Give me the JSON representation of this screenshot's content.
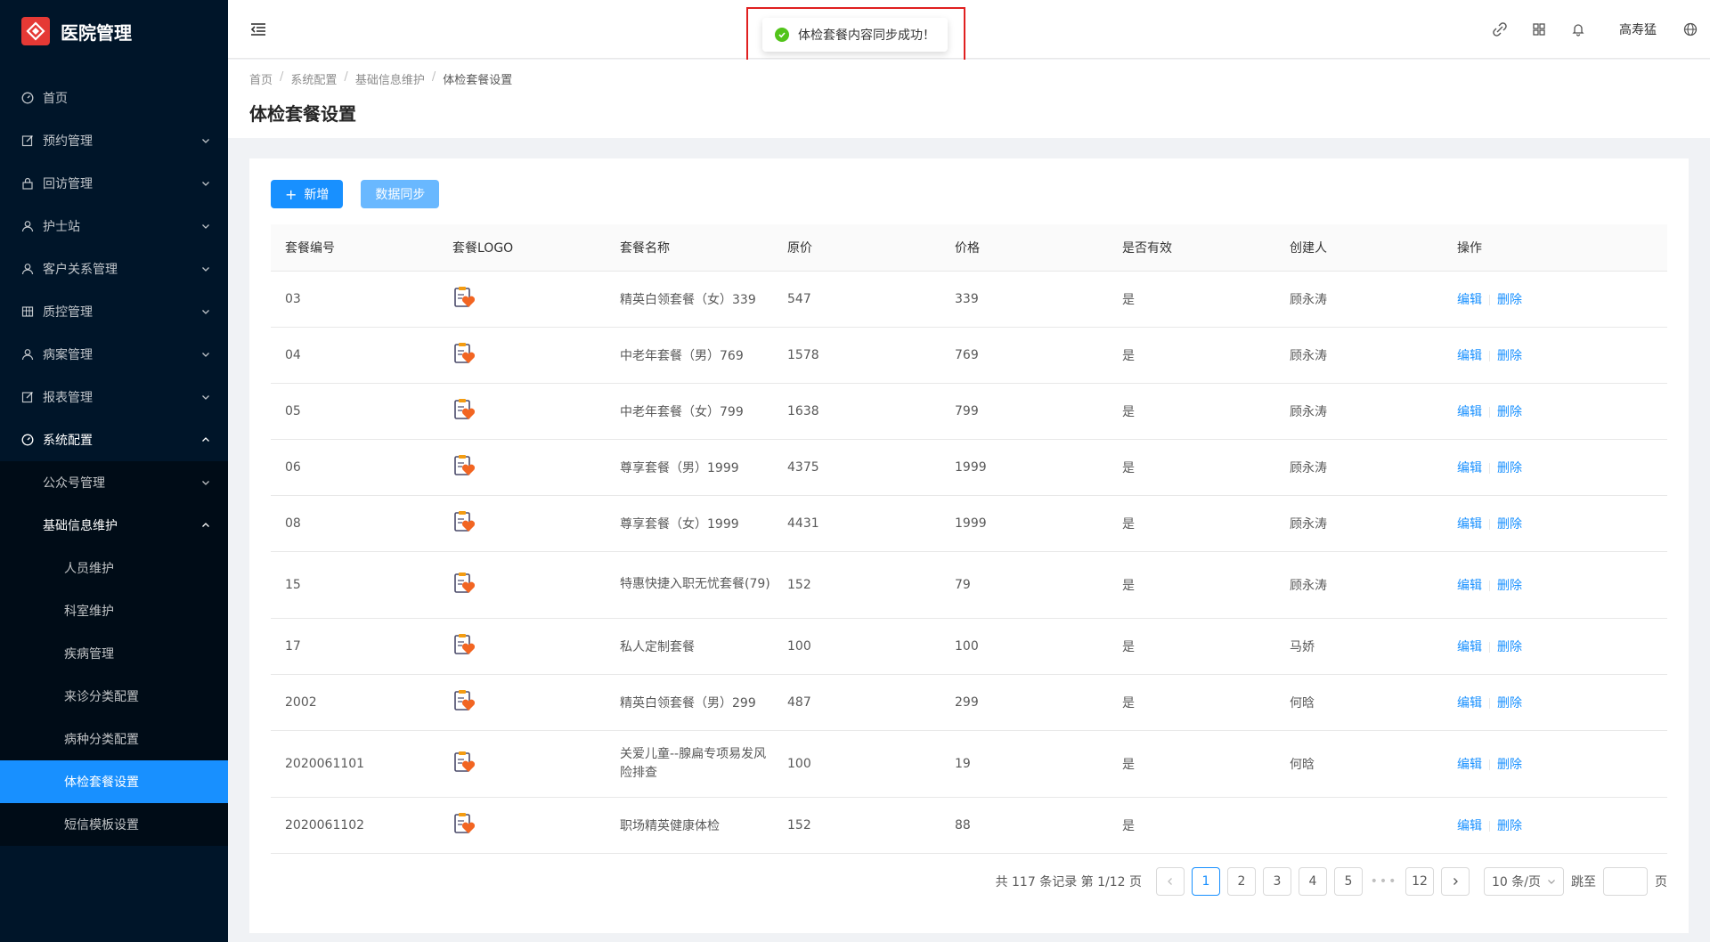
{
  "app": {
    "title": "医院管理"
  },
  "sidebar": {
    "items": [
      {
        "label": "首页",
        "icon": "dashboard-icon",
        "has_children": false
      },
      {
        "label": "预约管理",
        "icon": "edit-icon",
        "has_children": true
      },
      {
        "label": "回访管理",
        "icon": "lock-icon",
        "has_children": true
      },
      {
        "label": "护士站",
        "icon": "user-icon",
        "has_children": true
      },
      {
        "label": "客户关系管理",
        "icon": "user-icon",
        "has_children": true
      },
      {
        "label": "质控管理",
        "icon": "table-icon",
        "has_children": true
      },
      {
        "label": "病案管理",
        "icon": "user-icon",
        "has_children": true
      },
      {
        "label": "报表管理",
        "icon": "edit-icon",
        "has_children": true
      },
      {
        "label": "系统配置",
        "icon": "dashboard-icon",
        "has_children": true,
        "open": true
      }
    ],
    "system_sub": [
      {
        "label": "公众号管理",
        "open": false
      },
      {
        "label": "基础信息维护",
        "open": true
      }
    ],
    "basic_sub": [
      {
        "label": "人员维护"
      },
      {
        "label": "科室维护"
      },
      {
        "label": "疾病管理"
      },
      {
        "label": "来诊分类配置"
      },
      {
        "label": "病种分类配置"
      },
      {
        "label": "体检套餐设置",
        "selected": true
      },
      {
        "label": "短信模板设置"
      }
    ]
  },
  "header": {
    "user_name": "高寿猛"
  },
  "toast": {
    "message": "体检套餐内容同步成功！"
  },
  "breadcrumb": [
    "首页",
    "系统配置",
    "基础信息维护",
    "体检套餐设置"
  ],
  "page": {
    "title": "体检套餐设置"
  },
  "toolbar": {
    "add_label": "新增",
    "sync_label": "数据同步"
  },
  "table": {
    "columns": [
      "套餐编号",
      "套餐LOGO",
      "套餐名称",
      "原价",
      "价格",
      "是否有效",
      "创建人",
      "操作"
    ],
    "actions": {
      "edit": "编辑",
      "delete": "删除"
    },
    "rows": [
      {
        "id": "03",
        "name": "精英白领套餐（女）339",
        "orig": "547",
        "price": "339",
        "valid": "是",
        "creator": "顾永涛"
      },
      {
        "id": "04",
        "name": "中老年套餐（男）769",
        "orig": "1578",
        "price": "769",
        "valid": "是",
        "creator": "顾永涛"
      },
      {
        "id": "05",
        "name": "中老年套餐（女）799",
        "orig": "1638",
        "price": "799",
        "valid": "是",
        "creator": "顾永涛"
      },
      {
        "id": "06",
        "name": "尊享套餐（男）1999",
        "orig": "4375",
        "price": "1999",
        "valid": "是",
        "creator": "顾永涛"
      },
      {
        "id": "08",
        "name": "尊享套餐（女）1999",
        "orig": "4431",
        "price": "1999",
        "valid": "是",
        "creator": "顾永涛"
      },
      {
        "id": "15",
        "name": "特惠快捷入职无忧套餐(79)",
        "orig": "152",
        "price": "79",
        "valid": "是",
        "creator": "顾永涛"
      },
      {
        "id": "17",
        "name": "私人定制套餐",
        "orig": "100",
        "price": "100",
        "valid": "是",
        "creator": "马娇"
      },
      {
        "id": "2002",
        "name": "精英白领套餐（男）299",
        "orig": "487",
        "price": "299",
        "valid": "是",
        "creator": "何晗"
      },
      {
        "id": "2020061101",
        "name": "关爱儿童--腺扁专项易发风险排查",
        "orig": "100",
        "price": "19",
        "valid": "是",
        "creator": "何晗"
      },
      {
        "id": "2020061102",
        "name": "职场精英健康体检",
        "orig": "152",
        "price": "88",
        "valid": "是",
        "creator": ""
      }
    ]
  },
  "pagination": {
    "total_text": "共 117 条记录 第 1/12 页",
    "pages": [
      "1",
      "2",
      "3",
      "4",
      "5"
    ],
    "last_page": "12",
    "dots": "•••",
    "page_size": "10 条/页",
    "jump_label": "跳至",
    "page_unit": "页",
    "current": 1
  },
  "colors": {
    "primary": "#1890ff",
    "sidebar_bg": "#001529",
    "success": "#52c41a",
    "highlight_box": "#e02020"
  }
}
